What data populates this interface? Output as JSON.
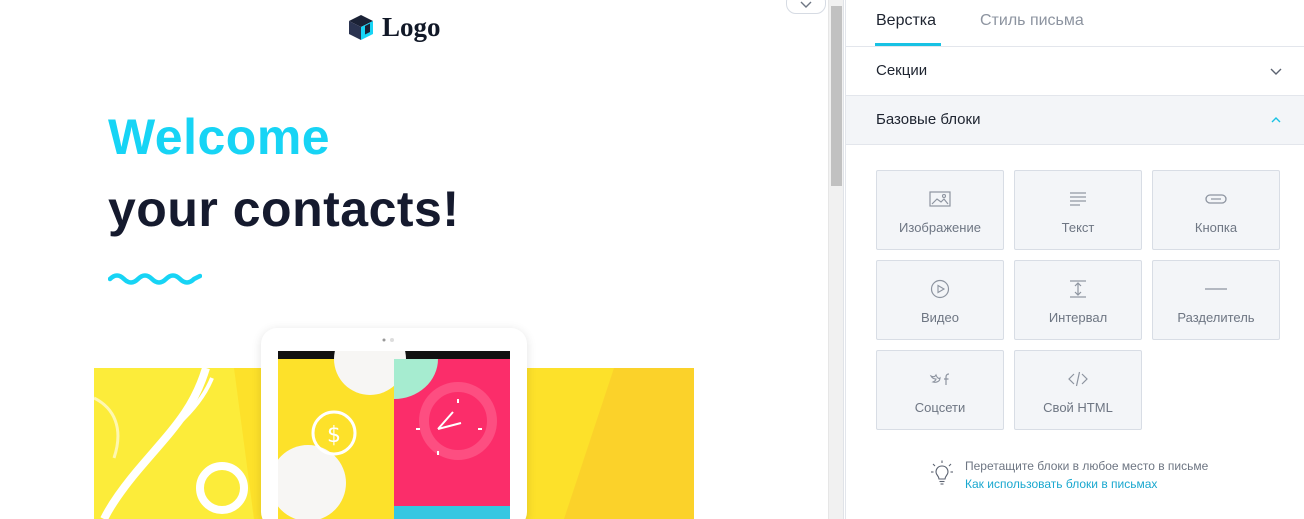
{
  "canvas": {
    "logo_text": "Logo",
    "hero_line1": "Welcome",
    "hero_line2": "your contacts!",
    "accent_color": "#17d4f5",
    "heading_color": "#151a2e"
  },
  "sidebar": {
    "tabs": [
      {
        "label": "Верстка",
        "active": true
      },
      {
        "label": "Стиль письма",
        "active": false
      }
    ],
    "accordions": [
      {
        "label": "Секции",
        "expanded": false
      },
      {
        "label": "Базовые блоки",
        "expanded": true
      }
    ],
    "blocks": [
      {
        "label": "Изображение",
        "icon": "image-icon"
      },
      {
        "label": "Текст",
        "icon": "text-icon"
      },
      {
        "label": "Кнопка",
        "icon": "button-icon"
      },
      {
        "label": "Видео",
        "icon": "play-icon"
      },
      {
        "label": "Интервал",
        "icon": "spacer-icon"
      },
      {
        "label": "Разделитель",
        "icon": "divider-icon"
      },
      {
        "label": "Соцсети",
        "icon": "social-icon"
      },
      {
        "label": "Свой HTML",
        "icon": "code-icon"
      }
    ],
    "hint": {
      "text": "Перетащите блоки в любое место в письме",
      "link": "Как использовать блоки в письмах"
    },
    "active_color": "#18c2e4"
  }
}
